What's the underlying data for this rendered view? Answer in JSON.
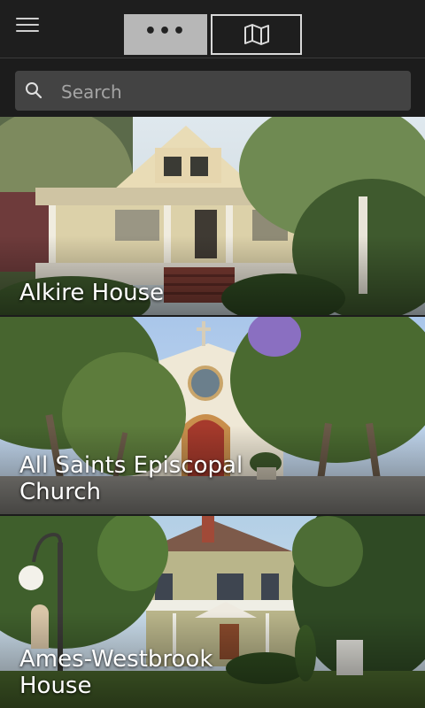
{
  "header": {
    "menu_icon": "hamburger-menu-icon",
    "list_tab_label": "•••",
    "map_tab_icon": "folded-map-icon"
  },
  "search": {
    "placeholder": "Search",
    "icon": "search-icon"
  },
  "places": [
    {
      "title": "Alkire House"
    },
    {
      "title": "All Saints Episcopal Church"
    },
    {
      "title": "Ames-Westbrook House"
    }
  ],
  "colors": {
    "topbar": "#1e1e1e",
    "active_tab": "#b7b7b7",
    "search_bg": "#434343"
  }
}
